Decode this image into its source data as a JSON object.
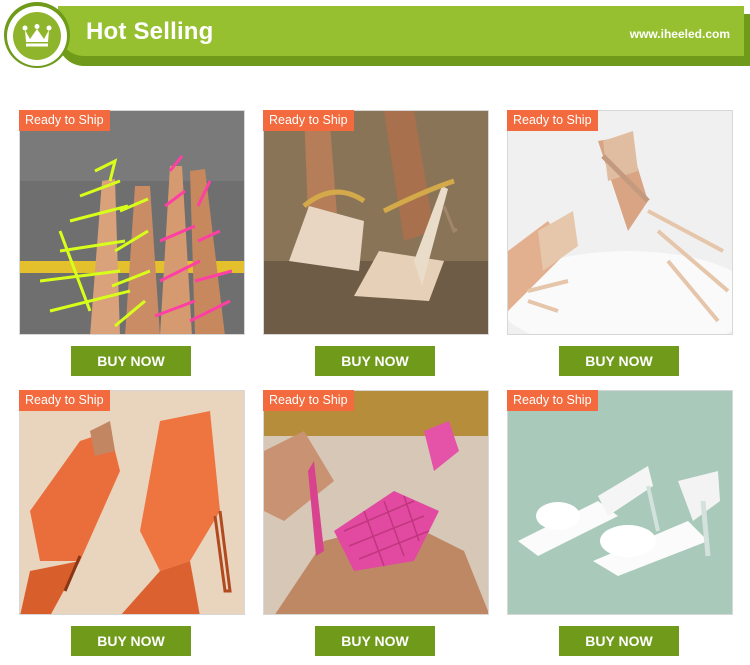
{
  "header": {
    "title": "Hot Selling",
    "site": "www.iheeled.com",
    "icon": "crown-icon",
    "colors": {
      "bar": "#96c030",
      "dark": "#6f9a1a"
    }
  },
  "products": [
    {
      "tag": "Ready to Ship",
      "button": "BUY NOW",
      "image": "neon lace-up knee-high sandals"
    },
    {
      "tag": "Ready to Ship",
      "button": "BUY NOW",
      "image": "nude chain mule heels"
    },
    {
      "tag": "Ready to Ship",
      "button": "BUY NOW",
      "image": "nude braided lace-up heels"
    },
    {
      "tag": "Ready to Ship",
      "button": "BUY NOW",
      "image": "orange knit sock booties"
    },
    {
      "tag": "Ready to Ship",
      "button": "BUY NOW",
      "image": "pink woven square-toe mules"
    },
    {
      "tag": "Ready to Ship",
      "button": "BUY NOW",
      "image": "white bow clear-heel mules"
    }
  ],
  "colors": {
    "tag": "#f26a3d",
    "button": "#6f9a1a"
  }
}
